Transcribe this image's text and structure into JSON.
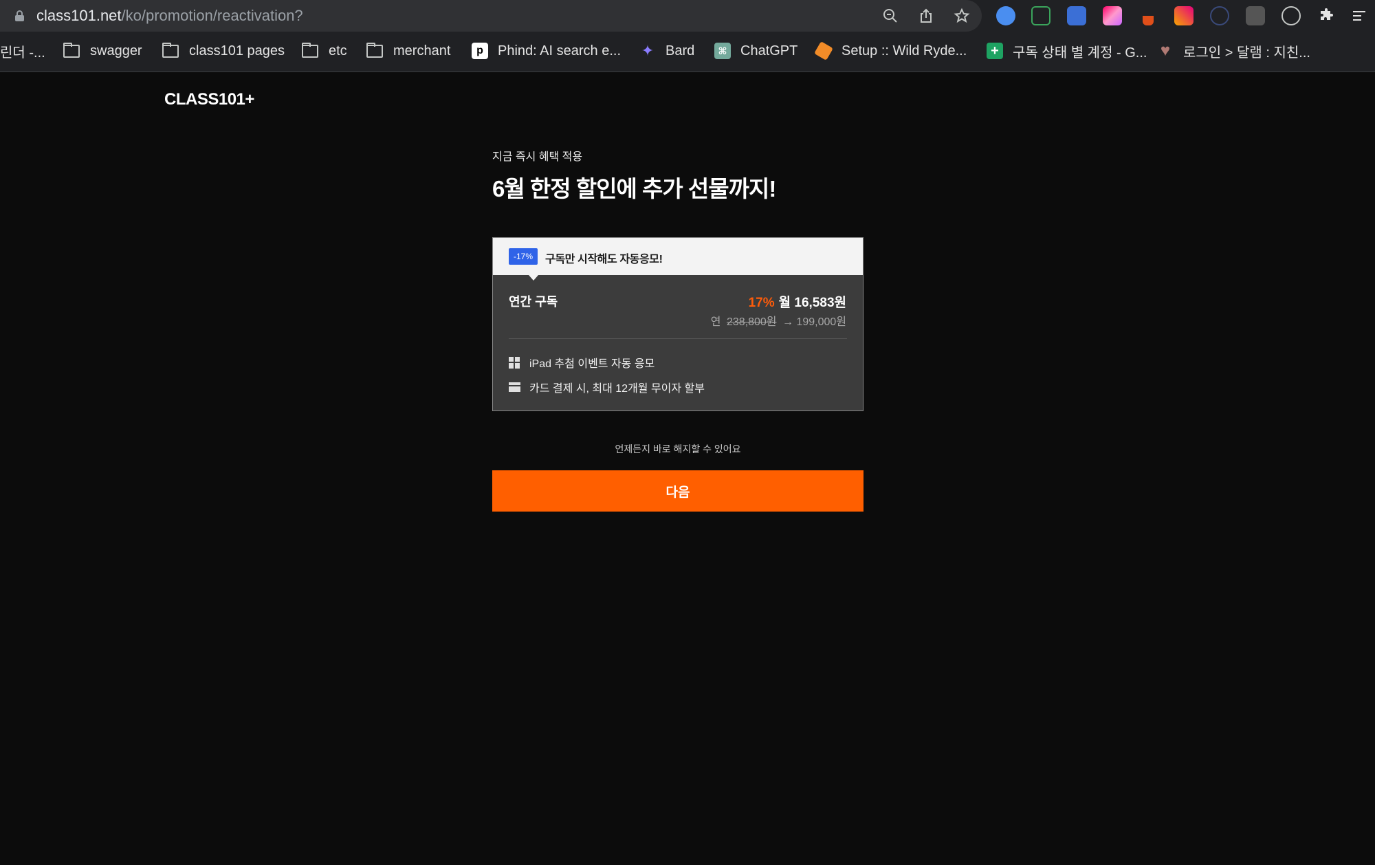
{
  "browser": {
    "url_host": "class101.net",
    "url_path": "/ko/promotion/reactivation?",
    "bookmarks": [
      {
        "label": "린더 -...",
        "icon": "none"
      },
      {
        "label": "swagger",
        "icon": "folder-icon"
      },
      {
        "label": "class101 pages",
        "icon": "folder-icon"
      },
      {
        "label": "etc",
        "icon": "folder-icon"
      },
      {
        "label": "merchant",
        "icon": "folder-icon"
      },
      {
        "label": "Phind: AI search e...",
        "icon": "phind-icon",
        "glyph": "p"
      },
      {
        "label": "Bard",
        "icon": "bard-sparkle-icon",
        "glyph": "✦"
      },
      {
        "label": "ChatGPT",
        "icon": "chatgpt-icon",
        "glyph": "⌘"
      },
      {
        "label": "Setup :: Wild Ryde...",
        "icon": "aws-cube-icon",
        "glyph": ""
      },
      {
        "label": "구독 상태 별 계정 - G...",
        "icon": "sheets-icon",
        "glyph": "+"
      },
      {
        "label": "로그인 > 달램 : 지친...",
        "icon": "heart-icon",
        "glyph": "♥"
      }
    ]
  },
  "page": {
    "logo": "CLASS101+",
    "eyebrow": "지금 즉시 혜택 적용",
    "headline": "6월 한정 할인에 추가 선물까지!",
    "card": {
      "badge": "-17%",
      "promo_text": "구독만 시작해도 자동응모!",
      "plan_name": "연간 구독",
      "discount_pct": "17%",
      "monthly_price": "월 16,583원",
      "year_prefix": "연",
      "original_price": "238,800원",
      "arrow": "→",
      "annual_price": "199,000원",
      "benefits": [
        {
          "icon": "gift-icon",
          "text": "iPad 추첨 이벤트 자동 응모"
        },
        {
          "icon": "credit-card-icon",
          "text": "카드 결제 시, 최대 12개월 무이자 할부"
        }
      ]
    },
    "cancel_note": "언제든지 바로 해지할 수 있어요",
    "next_button": "다음"
  },
  "colors": {
    "accent": "#ff5f00",
    "badge": "#2f63e8",
    "background": "#0c0c0c"
  }
}
